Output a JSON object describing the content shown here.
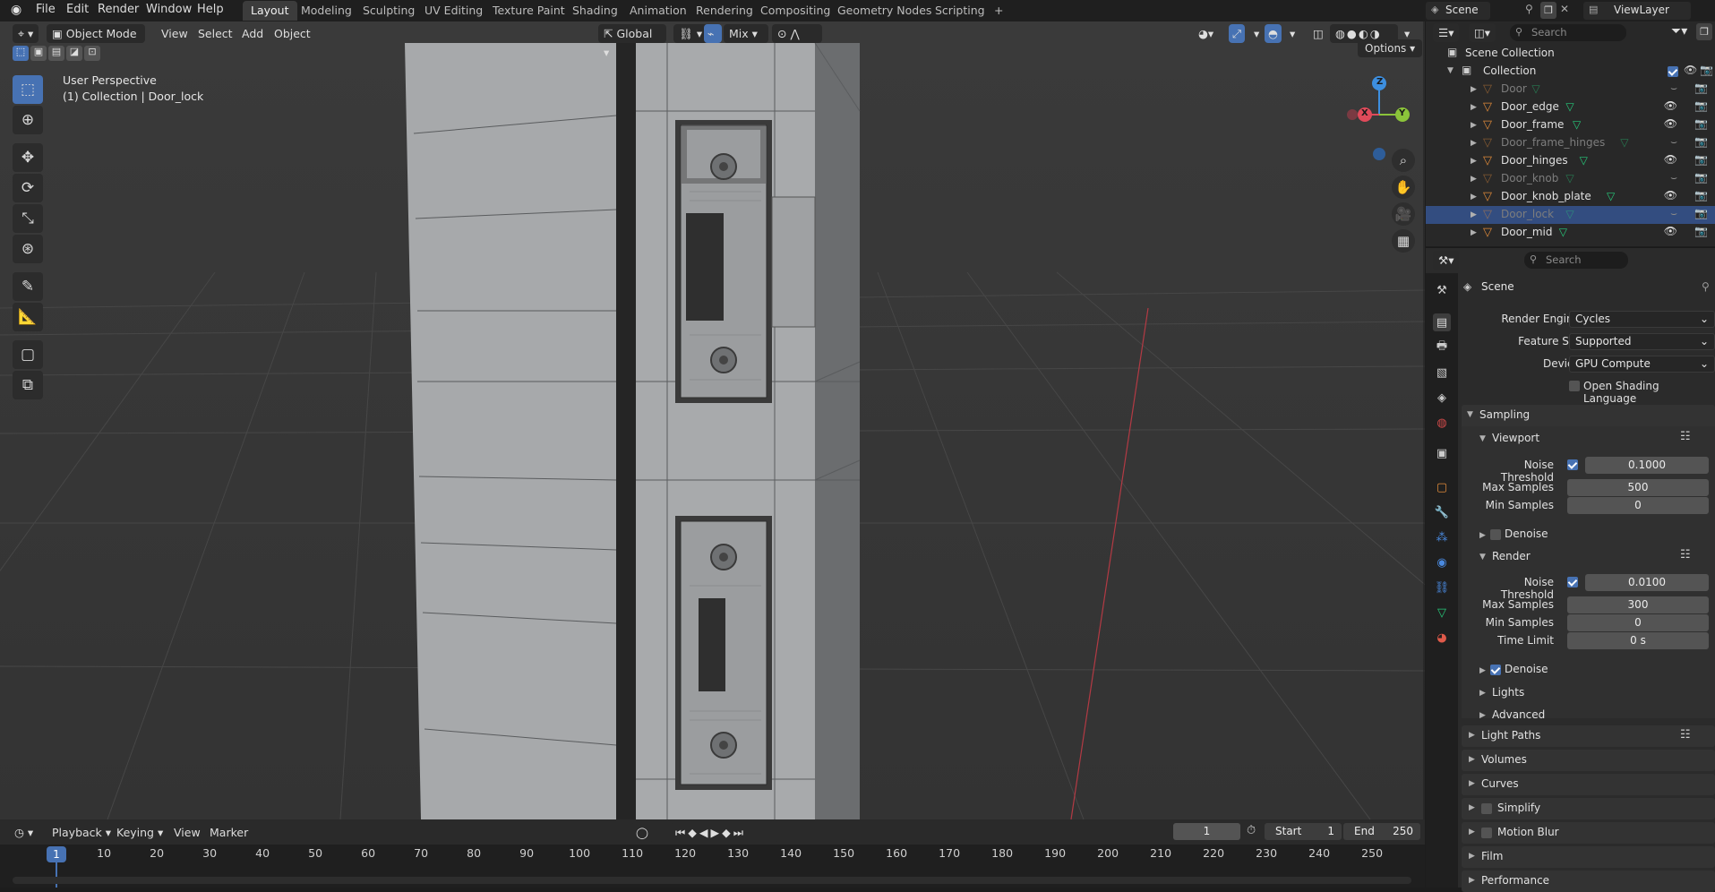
{
  "topbar": {
    "menus": [
      "File",
      "Edit",
      "Render",
      "Window",
      "Help"
    ],
    "workspaces": [
      "Layout",
      "Modeling",
      "Sculpting",
      "UV Editing",
      "Texture Paint",
      "Shading",
      "Animation",
      "Rendering",
      "Compositing",
      "Geometry Nodes",
      "Scripting"
    ],
    "active_workspace": "Layout",
    "add_tab": "+",
    "scene": "Scene",
    "view_layer": "ViewLayer"
  },
  "viewport": {
    "mode": "Object Mode",
    "menus": [
      "View",
      "Select",
      "Add",
      "Object"
    ],
    "orientation": "Global",
    "snap_mode": "Mix",
    "options": "Options",
    "perspective": "User Perspective",
    "context": "(1) Collection | Door_lock",
    "gizmo": {
      "x": "X",
      "y": "Y",
      "z": "Z"
    }
  },
  "timeline": {
    "menus": [
      "Playback",
      "Keying",
      "View",
      "Marker"
    ],
    "current_frame": "1",
    "start_label": "Start",
    "start": "1",
    "end_label": "End",
    "end": "250",
    "frame_cursor": "1",
    "ruler": [
      "10",
      "20",
      "30",
      "40",
      "50",
      "60",
      "70",
      "80",
      "90",
      "100",
      "110",
      "120",
      "130",
      "140",
      "150",
      "160",
      "170",
      "180",
      "190",
      "200",
      "210",
      "220",
      "230",
      "240",
      "250"
    ]
  },
  "outliner": {
    "search_placeholder": "Search",
    "scene_collection": "Scene Collection",
    "collection": "Collection",
    "items": [
      {
        "name": "Door",
        "dim": true
      },
      {
        "name": "Door_edge",
        "dim": false
      },
      {
        "name": "Door_frame",
        "dim": false
      },
      {
        "name": "Door_frame_hinges",
        "dim": true
      },
      {
        "name": "Door_hinges",
        "dim": false
      },
      {
        "name": "Door_knob",
        "dim": true
      },
      {
        "name": "Door_knob_plate",
        "dim": false
      },
      {
        "name": "Door_lock",
        "dim": true,
        "selected": true
      },
      {
        "name": "Door_mid",
        "dim": false
      }
    ]
  },
  "properties": {
    "search_placeholder": "Search",
    "context": "Scene",
    "render_engine_label": "Render Engine",
    "render_engine": "Cycles",
    "feature_set_label": "Feature Set",
    "feature_set": "Supported",
    "device_label": "Device",
    "device": "GPU Compute",
    "osl_label": "Open Shading Language",
    "sampling": "Sampling",
    "viewport": {
      "title": "Viewport",
      "noise_threshold_label": "Noise Threshold",
      "noise_threshold": "0.1000",
      "max_samples_label": "Max Samples",
      "max_samples": "500",
      "min_samples_label": "Min Samples",
      "min_samples": "0",
      "denoise": "Denoise"
    },
    "render": {
      "title": "Render",
      "noise_threshold_label": "Noise Threshold",
      "noise_threshold": "0.0100",
      "max_samples_label": "Max Samples",
      "max_samples": "300",
      "min_samples_label": "Min Samples",
      "min_samples": "0",
      "time_limit_label": "Time Limit",
      "time_limit": "0 s",
      "denoise": "Denoise"
    },
    "lights": "Lights",
    "advanced": "Advanced",
    "panels": [
      "Light Paths",
      "Volumes",
      "Curves",
      "Simplify",
      "Motion Blur",
      "Film",
      "Performance"
    ]
  },
  "colors": {
    "accent": "#4772b3",
    "x_axis": "#e04a5a",
    "y_axis": "#8bc43a",
    "z_axis": "#3d8fe0",
    "mesh_icon": "#e08a3a",
    "data_icon": "#27c97a"
  }
}
